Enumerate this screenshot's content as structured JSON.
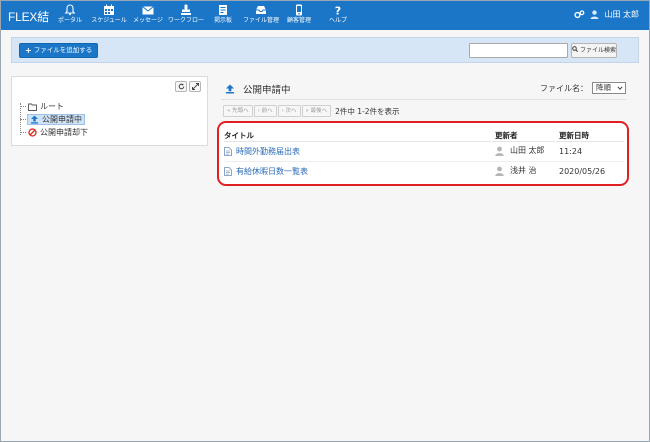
{
  "app": {
    "logo": "FLEX結"
  },
  "nav": {
    "items": [
      {
        "label": "ポータル",
        "icon": "bell-icon"
      },
      {
        "label": "スケジュール",
        "icon": "calendar-icon"
      },
      {
        "label": "メッセージ",
        "icon": "mail-icon"
      },
      {
        "label": "ワークフロー",
        "icon": "stamp-icon"
      },
      {
        "label": "掲示板",
        "icon": "board-icon"
      },
      {
        "label": "ファイル管理",
        "icon": "inbox-icon"
      },
      {
        "label": "顧客管理",
        "icon": "phone-icon"
      },
      {
        "label": "ヘルプ",
        "icon": "question-icon"
      }
    ],
    "user_name": "山田 太郎"
  },
  "toolbar": {
    "add_file_label": "ファイルを追加する",
    "search_placeholder": "",
    "search_button_label": "ファイル検索"
  },
  "tree": {
    "root_label": "ルート",
    "items": [
      {
        "label": "公開申請中",
        "selected": true
      },
      {
        "label": "公開申請却下",
        "selected": false
      }
    ]
  },
  "main": {
    "title": "公開申請中",
    "sort_label": "ファイル名：",
    "sort_value": "降順",
    "pager": {
      "first": "« 先頭へ",
      "prev": "‹ 前へ",
      "next": "› 次へ",
      "last": "» 最後へ",
      "status": "2件中 1-2件を表示"
    },
    "table": {
      "headers": {
        "title": "タイトル",
        "updater": "更新者",
        "updated_at": "更新日時"
      },
      "rows": [
        {
          "title": "時間外勤務届出表",
          "updater": "山田 太郎",
          "updated_at": "11:24"
        },
        {
          "title": "有給休暇日数一覧表",
          "updater": "浅井 治",
          "updated_at": "2020/05/26"
        }
      ]
    }
  },
  "colors": {
    "nav_bg": "#1b76c8",
    "toolbar_bg": "#d6e6f7",
    "highlight": "#e0201f",
    "link": "#2a6bb8"
  }
}
